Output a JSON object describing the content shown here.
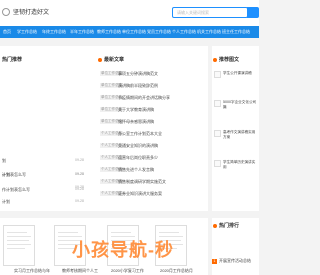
{
  "header": {
    "site_title": "坚韧打造好文",
    "search_placeholder": "请输入关键词搜索"
  },
  "nav": {
    "items": [
      "首页",
      "学工作总结",
      "年终工作总结",
      "半年工作总结",
      "教师工作总结",
      "单位工作总结",
      "党员工作总结",
      "个人工作总结",
      "机关工作总结",
      "班主任工作总结"
    ]
  },
  "left_panel": {
    "title": "热门推荐",
    "items": [
      {
        "label": "划",
        "date": "09-28"
      },
      {
        "label": "计划",
        "date": "09-28"
      },
      {
        "label": "作计划表怎么写",
        "date": "09-28"
      },
      {
        "label": "计划",
        "date": "09-28"
      },
      {
        "label": "计划表怎么写",
        "date": "09-28"
      },
      {
        "label": "",
        "date": "09-28"
      }
    ]
  },
  "latest": {
    "title": "最新文章",
    "items": [
      {
        "tag": "单位工作总结",
        "title": "事项五分钟演讲稿范文"
      },
      {
        "tag": "单位工作总结",
        "title": "演讲稿前半段致辞范例"
      },
      {
        "tag": "单位工作总结",
        "title": "节疫情期间的开会讲话稿分享"
      },
      {
        "tag": "单位工作总结",
        "title": "关于大学教育演讲稿"
      },
      {
        "tag": "单位工作总结",
        "title": "铭怀母亲感恩演讲稿"
      },
      {
        "tag": "个人工作总结",
        "title": "办公室工作计划范本大全"
      },
      {
        "tag": "个人工作总结",
        "title": "交通安全知识的演讲稿"
      },
      {
        "tag": "个人工作总结",
        "title": "运营年后岗位职责多少"
      },
      {
        "tag": "个人工作总结",
        "title": "销售先进个人发言稿"
      },
      {
        "tag": "个人工作总结",
        "title": "销售制度调研学期实施范文"
      },
      {
        "tag": "个人工作总结",
        "title": "证券业知识演讲大服务案"
      }
    ]
  },
  "recommended": {
    "title": "推荐图文",
    "items": [
      "学生公开课演讲稿",
      "5000字企业文化公司篇",
      "高考作文演讲稿实用方案",
      "学生简单历史演讲实用"
    ]
  },
  "documents": {
    "items": [
      "实习月工作总结与年",
      "教师考核期间个人工",
      "2020小学复习工作",
      "2020月工作总结月"
    ]
  },
  "hot": {
    "title": "热门排行",
    "items": [
      "开展宣传活动总结"
    ]
  },
  "watermark": "小孩导航-秒"
}
